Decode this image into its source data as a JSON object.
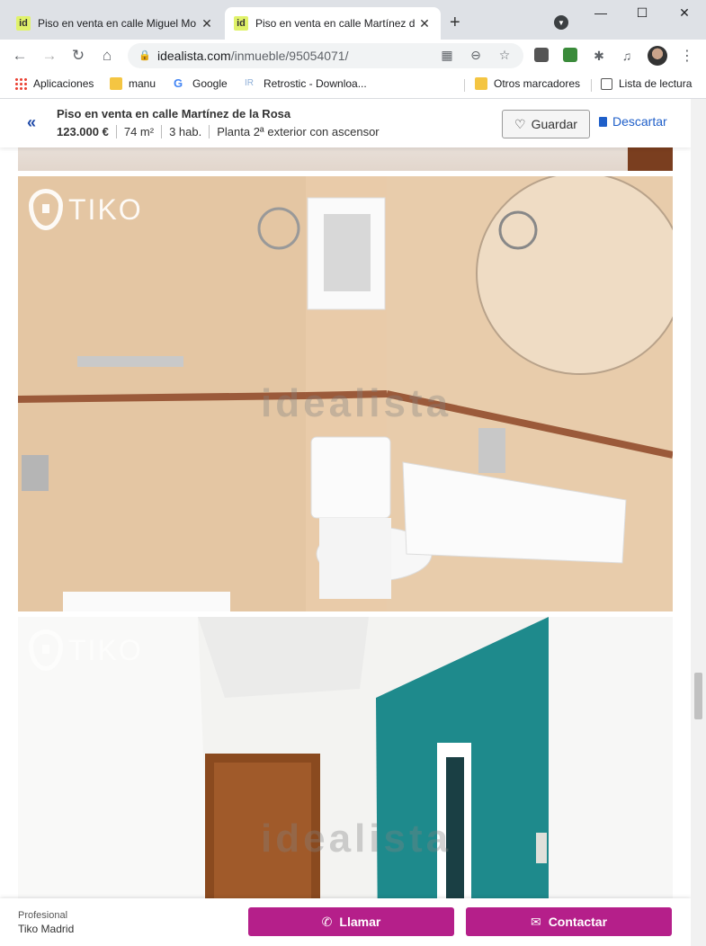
{
  "browser": {
    "tabs": [
      {
        "label": "Piso en venta en calle Miguel Mo",
        "favicon": "id"
      },
      {
        "label": "Piso en venta en calle Martínez d",
        "favicon": "id"
      }
    ],
    "new_tab_icon": "+",
    "window_controls": {
      "minimize": "—",
      "maximize": "☐",
      "close": "✕"
    },
    "url_host": "idealista.com",
    "url_path": "/inmueble/95054071/",
    "bookmarks": [
      {
        "label": "Aplicaciones",
        "icon": "apps-grid-icon"
      },
      {
        "label": "manu",
        "icon": "folder-icon"
      },
      {
        "label": "Google",
        "icon": "google-icon"
      },
      {
        "label": "Retrostic - Downloa...",
        "icon": "retrostic-icon"
      },
      {
        "label": "Otros marcadores",
        "icon": "folder-icon"
      },
      {
        "label": "Lista de lectura",
        "icon": "reading-list-icon"
      }
    ]
  },
  "listing": {
    "title": "Piso en venta en calle Martínez de la Rosa",
    "price": "123.000 €",
    "size": "74 m²",
    "rooms": "3 hab.",
    "floor": "Planta 2ª exterior con ascensor",
    "save_label": "Guardar",
    "discard_label": "Descartar"
  },
  "photos": {
    "watermark": "idealista",
    "brand": "TIKO"
  },
  "contact": {
    "kind": "Profesional",
    "agency": "Tiko Madrid",
    "call_label": "Llamar",
    "contact_label": "Contactar"
  },
  "colors": {
    "accent": "#b51f8a",
    "link_blue": "#1f5fc9"
  }
}
